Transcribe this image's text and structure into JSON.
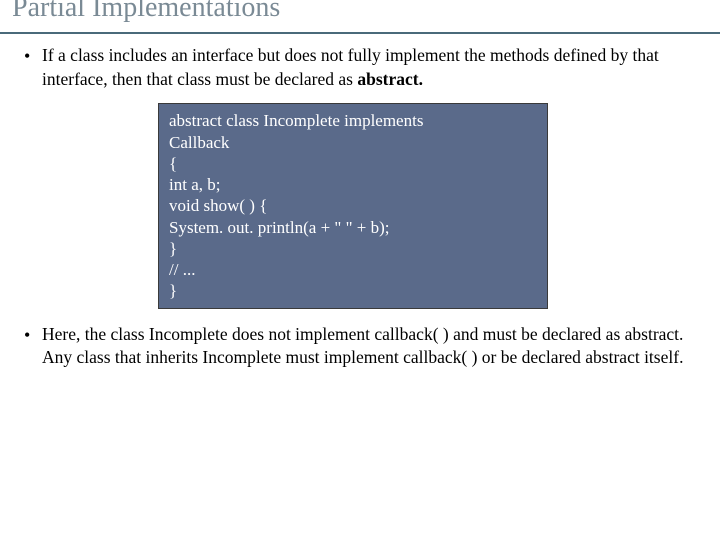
{
  "title": "Partial Implementations",
  "bullets": [
    {
      "pre": "If a class includes an interface but does not fully implement the methods defined by that interface, then that class must be declared as ",
      "bold": "abstract."
    },
    {
      "text": "Here, the class Incomplete does not implement callback( ) and must be declared as abstract. Any class that inherits Incomplete must implement callback( ) or be declared abstract itself."
    }
  ],
  "code": [
    "abstract class Incomplete implements",
    "Callback",
    "{",
    "int a, b;",
    "void show( ) {",
    "System. out. println(a + \" \" + b);",
    "}",
    "// ...",
    "}"
  ]
}
